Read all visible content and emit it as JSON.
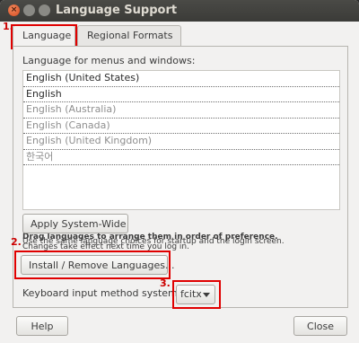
{
  "window": {
    "title": "Language Support"
  },
  "tabs": [
    {
      "label": "Language"
    },
    {
      "label": "Regional Formats"
    }
  ],
  "annotations": {
    "n1": "1.",
    "n2": "2.",
    "n3": "3."
  },
  "language_tab": {
    "section_label": "Language for menus and windows:",
    "languages": [
      {
        "label": "English (United States)"
      },
      {
        "label": "English"
      },
      {
        "label": "English (Australia)"
      },
      {
        "label": "English (Canada)"
      },
      {
        "label": "English (United Kingdom)"
      },
      {
        "label": "한국어"
      }
    ],
    "drag_hint": "Drag languages to arrange them in order of preference.",
    "drag_subhint": "Changes take effect next time you log in.",
    "apply_button": "Apply System-Wide",
    "apply_note": "Use the same language choices for startup and the login screen.",
    "install_button": "Install / Remove Languages...",
    "keyboard_label": "Keyboard input method system:",
    "keyboard_value": "fcitx"
  },
  "footer": {
    "help_button": "Help",
    "close_button": "Close"
  }
}
